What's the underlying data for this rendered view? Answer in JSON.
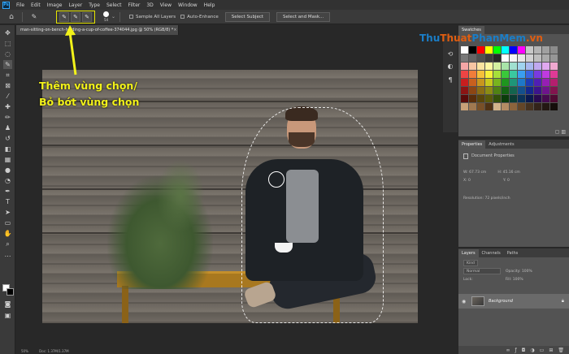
{
  "menubar": {
    "logo": "Ps",
    "items": [
      "File",
      "Edit",
      "Image",
      "Layer",
      "Type",
      "Select",
      "Filter",
      "3D",
      "View",
      "Window",
      "Help"
    ]
  },
  "options": {
    "home_icon": "home-icon",
    "preset_icon": "quick-selection-preset-icon",
    "modes": [
      {
        "name": "new-selection",
        "glyph": "✎"
      },
      {
        "name": "add-to-selection",
        "glyph": "✎"
      },
      {
        "name": "subtract-from-selection",
        "glyph": "✎"
      }
    ],
    "brush_size": "54",
    "sample_all_layers": "Sample All Layers",
    "auto_enhance": "Auto-Enhance",
    "select_subject": "Select Subject",
    "select_and_mask": "Select and Mask..."
  },
  "document": {
    "tab_title": "man-sitting-on-bench-holding-a-cup-of-coffee-374044.jpg @ 50% (RGB/8) *",
    "tab_close": "×",
    "status_zoom": "50%",
    "status_doc": "Doc: 1.37M/1.37M"
  },
  "annotation": {
    "line1": "Thêm vùng chọn/",
    "line2": "Bỏ bớt vùng chọn",
    "color": "#f2f21a"
  },
  "watermark": {
    "part1": "Thu",
    "part2": "Thuat",
    "part3": "PhanMem",
    "part4": ".vn"
  },
  "swatches": {
    "tab_label": "Swatches",
    "colors": [
      "#ffffff",
      "#000000",
      "#ff0000",
      "#ffff00",
      "#00ff00",
      "#00ffff",
      "#0000ff",
      "#ff00ff",
      "#c8c8c8",
      "#b4b4b4",
      "#a0a0a0",
      "#8c8c8c",
      "#787878",
      "#646464",
      "#505050",
      "#3c3c3c",
      "#282828",
      "#ffffff",
      "#f5f5f5",
      "#e6e6e6",
      "#d2d2d2",
      "#bebebe",
      "#aaaaaa",
      "#969696",
      "#f4a6a6",
      "#f7c6a3",
      "#fbe4a0",
      "#fff7a3",
      "#d4f0a0",
      "#a8e4a8",
      "#a0e0d0",
      "#a0d4f0",
      "#a8b8f0",
      "#c0a8f0",
      "#e0a8f0",
      "#f0a8d0",
      "#ee4444",
      "#f07d3a",
      "#f5c03a",
      "#f7f03a",
      "#a6e03a",
      "#3ac83a",
      "#3ac8a0",
      "#3a9ef0",
      "#3a64e0",
      "#7a3ae0",
      "#c03ae0",
      "#e03a96",
      "#c81e1e",
      "#c8601e",
      "#c8961e",
      "#c8c81e",
      "#78b41e",
      "#1e961e",
      "#1e9678",
      "#1e78c8",
      "#1e3cb4",
      "#501eb4",
      "#961eb4",
      "#b41e6e",
      "#8c1414",
      "#8c4614",
      "#8c6e14",
      "#8c8c14",
      "#508214",
      "#146414",
      "#14644e",
      "#14508c",
      "#14288c",
      "#3c148c",
      "#6e148c",
      "#82144e",
      "#5a0a0a",
      "#5a2d0a",
      "#5a460a",
      "#5a5a0a",
      "#32500a",
      "#0a3c0a",
      "#0a3c32",
      "#0a325a",
      "#0a1950",
      "#280a50",
      "#460a50",
      "#500a32",
      "#c8a078",
      "#a07850",
      "#785028",
      "#503214",
      "#d2b48c",
      "#b48c64",
      "#8c643c",
      "#644628",
      "#463220",
      "#32231a",
      "#231812",
      "#140e0a"
    ]
  },
  "properties": {
    "tabs": [
      "Properties",
      "Adjustments"
    ],
    "title": "Document Properties",
    "w": "W: 67.73 cm",
    "h": "H: 45.16 cm",
    "x": "X: 0",
    "y": "Y: 0",
    "resolution": "Resolution: 72 pixels/inch"
  },
  "layers": {
    "tabs": [
      "Layers",
      "Channels",
      "Paths"
    ],
    "kind": "Kind",
    "blend": "Normal",
    "opacity": "Opacity: 100%",
    "lock": "Lock:",
    "fill": "Fill: 100%",
    "layer_name": "Background"
  }
}
